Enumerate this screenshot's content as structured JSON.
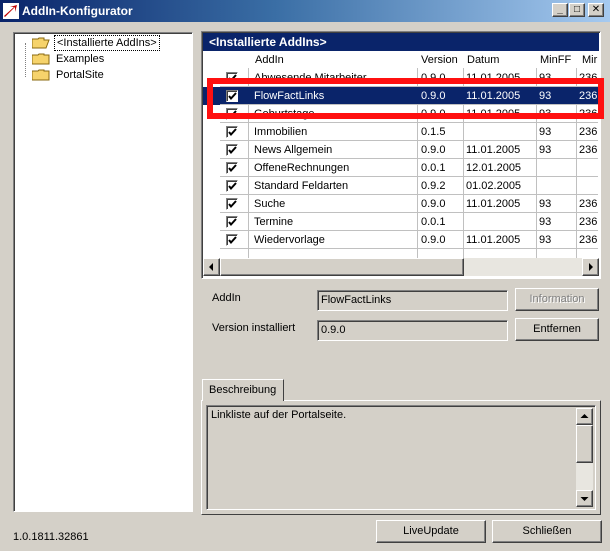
{
  "window": {
    "title": "AddIn-Konfigurator",
    "buttons": {
      "minimize": "_",
      "maximize": "□",
      "close": "✕"
    }
  },
  "tree": {
    "items": [
      {
        "label": "<Installierte AddIns>",
        "icon": "folder-open-icon"
      },
      {
        "label": "Examples",
        "icon": "folder-icon"
      },
      {
        "label": "PortalSite",
        "icon": "folder-icon"
      }
    ]
  },
  "list": {
    "title": "<Installierte AddIns>",
    "columns": [
      "AddIn",
      "Version",
      "Datum",
      "MinFF",
      "Mir"
    ],
    "rows": [
      {
        "checked": true,
        "name": "Abwesende Mitarbeiter",
        "version": "0.9.0",
        "date": "11.01.2005",
        "minff": "93",
        "mir": "236"
      },
      {
        "checked": true,
        "name": "FlowFactLinks",
        "version": "0.9.0",
        "date": "11.01.2005",
        "minff": "93",
        "mir": "236",
        "selected": true
      },
      {
        "checked": true,
        "name": "Geburtstage",
        "version": "0.9.0",
        "date": "11.01.2005",
        "minff": "93",
        "mir": "236"
      },
      {
        "checked": true,
        "name": "Immobilien",
        "version": "0.1.5",
        "date": "",
        "minff": "93",
        "mir": "236"
      },
      {
        "checked": true,
        "name": "News Allgemein",
        "version": "0.9.0",
        "date": "11.01.2005",
        "minff": "93",
        "mir": "236"
      },
      {
        "checked": true,
        "name": "OffeneRechnungen",
        "version": "0.0.1",
        "date": "12.01.2005",
        "minff": "",
        "mir": ""
      },
      {
        "checked": true,
        "name": "Standard Feldarten",
        "version": "0.9.2",
        "date": "01.02.2005",
        "minff": "",
        "mir": ""
      },
      {
        "checked": true,
        "name": "Suche",
        "version": "0.9.0",
        "date": "11.01.2005",
        "minff": "93",
        "mir": "236"
      },
      {
        "checked": true,
        "name": "Termine",
        "version": "0.0.1",
        "date": "",
        "minff": "93",
        "mir": "236"
      },
      {
        "checked": true,
        "name": "Wiedervorlage",
        "version": "0.9.0",
        "date": "11.01.2005",
        "minff": "93",
        "mir": "236"
      }
    ]
  },
  "form": {
    "addin_label": "AddIn",
    "addin_value": "FlowFactLinks",
    "version_label": "Version installiert",
    "version_value": "0.9.0",
    "information_button": "Information",
    "remove_button": "Entfernen"
  },
  "description": {
    "tab_label": "Beschreibung",
    "text": "Linkliste auf der Portalseite."
  },
  "footer": {
    "version": "1.0.1811.32861",
    "liveupdate_button": "LiveUpdate",
    "close_button": "Schließen"
  },
  "colors": {
    "selection": "#0a246a",
    "annotation": "#ff1010",
    "face": "#d4d0c8"
  }
}
